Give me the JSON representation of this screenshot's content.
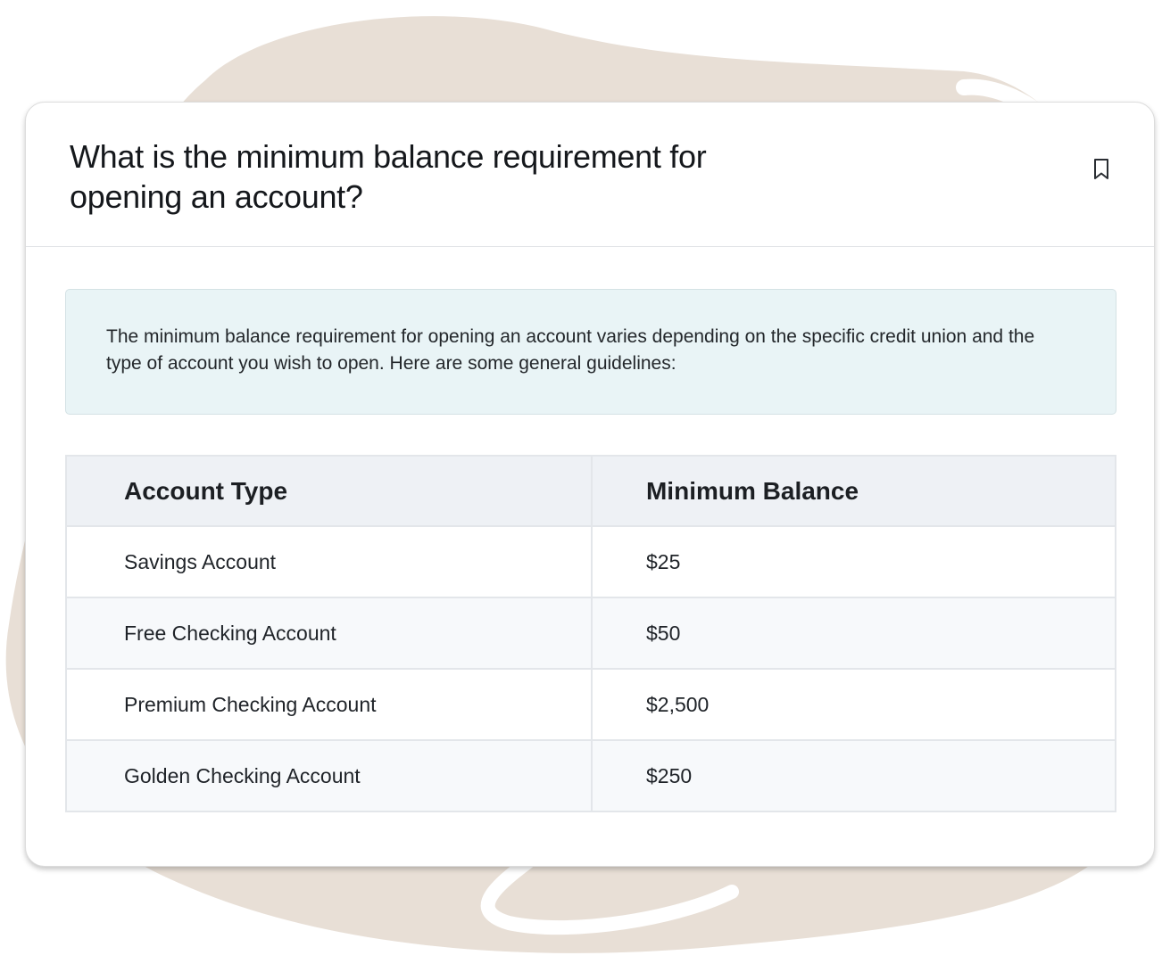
{
  "question": {
    "title": "What is the minimum balance requirement for opening an account?"
  },
  "icons": {
    "bookmark": "bookmark-icon"
  },
  "info": {
    "text": "The minimum balance requirement for opening an account varies depending on the specific credit union and the type of account you wish to open. Here are some general guidelines:"
  },
  "table": {
    "headers": [
      "Account Type",
      "Minimum Balance"
    ],
    "rows": [
      [
        "Savings Account",
        "$25"
      ],
      [
        "Free Checking Account",
        "$50"
      ],
      [
        "Premium Checking Account",
        "$2,500"
      ],
      [
        "Golden Checking Account",
        "$250"
      ]
    ]
  },
  "colors": {
    "background_blob": "#e8dfd6",
    "info_background": "#e9f4f6",
    "table_header_background": "#eef1f5"
  }
}
